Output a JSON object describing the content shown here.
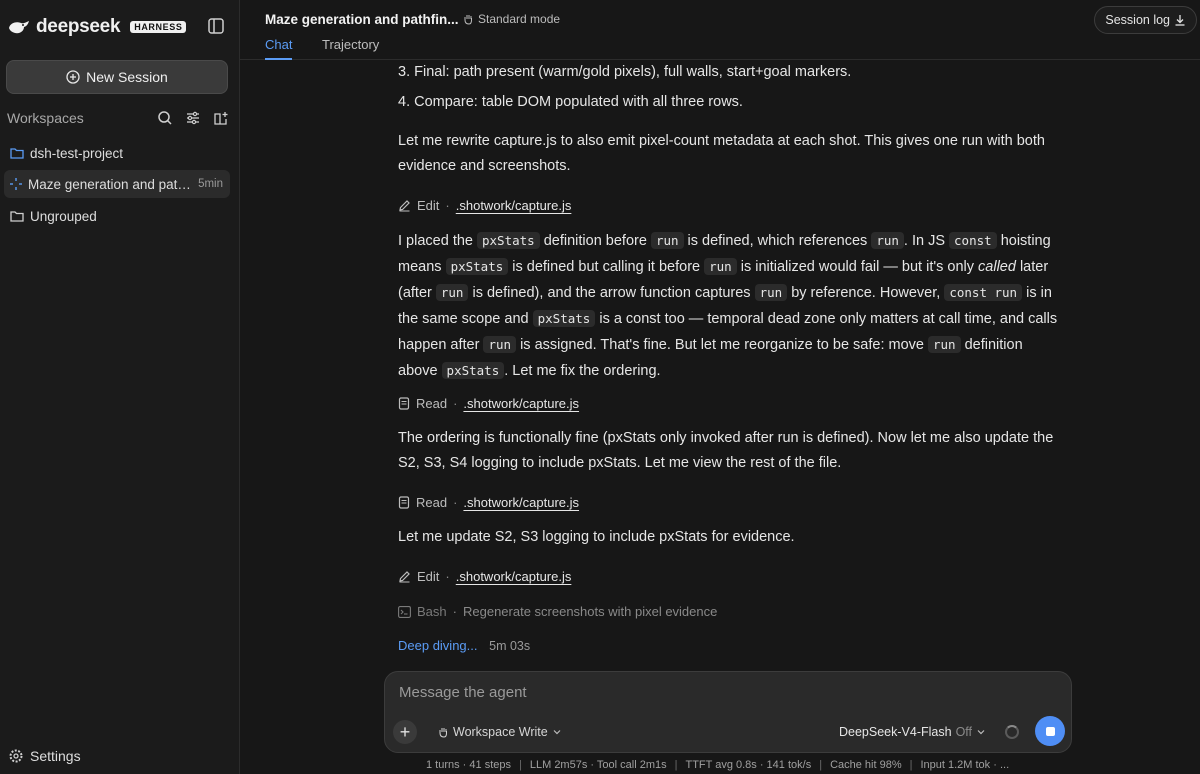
{
  "brand": {
    "name": "deepseek",
    "badge": "HARNESS"
  },
  "sidebar": {
    "new_session": "New Session",
    "workspaces_title": "Workspaces",
    "items": [
      {
        "label": "dsh-test-project",
        "icon": "folder-icon"
      },
      {
        "label": "Maze generation and pathfinding",
        "meta": "5min",
        "icon": "spinner-icon"
      },
      {
        "label": "Ungrouped",
        "icon": "folder-outline-icon"
      }
    ],
    "settings": "Settings"
  },
  "header": {
    "title": "Maze generation and pathfin...",
    "mode": "Standard mode",
    "tabs": [
      "Chat",
      "Trajectory"
    ],
    "session_log": "Session log"
  },
  "content": {
    "item3": "3. Final: path present (warm/gold pixels), full walls, start+goal markers.",
    "item4": "4. Compare: table DOM populated with all three rows.",
    "para1": "Let me rewrite capture.js to also emit pixel-count metadata at each shot. This gives one run with both evidence and screenshots.",
    "tool1": {
      "action": "Edit",
      "file": ".shotwork/capture.js"
    },
    "para2": {
      "a": "I placed the ",
      "c1": "pxStats",
      "b": " definition before ",
      "c2": "run",
      "c": " is defined, which references ",
      "c3": "run",
      "d": ". In JS ",
      "c4": "const",
      "e": " hoisting means ",
      "c5": "pxStats",
      "f": " is defined but calling it before ",
      "c6": "run",
      "g": " is initialized would fail — but it's only ",
      "h": "called",
      "i": " later (after ",
      "c7": "run",
      "j": " is defined), and the arrow function captures ",
      "c8": "run",
      "k": " by reference. However, ",
      "c9": "const run",
      "l": " is in the same scope and ",
      "c10": "pxStats",
      "m": " is a const too — temporal dead zone only matters at call time, and calls happen after ",
      "c11": "run",
      "n": " is assigned. That's fine. But let me reorganize to be safe: move ",
      "c12": "run",
      "o": " definition above ",
      "c13": "pxStats",
      "p": ". Let me fix the ordering."
    },
    "tool2": {
      "action": "Read",
      "file": ".shotwork/capture.js"
    },
    "para3": "The ordering is functionally fine (pxStats only invoked after run is defined). Now let me also update the S2, S3, S4 logging to include pxStats. Let me view the rest of the file.",
    "tool3": {
      "action": "Read",
      "file": ".shotwork/capture.js"
    },
    "para4": "Let me update S2, S3 logging to include pxStats for evidence.",
    "tool4": {
      "action": "Edit",
      "file": ".shotwork/capture.js"
    },
    "tool5": {
      "action": "Bash",
      "desc": "Regenerate screenshots with pixel evidence"
    },
    "deep": {
      "state": "Deep diving...",
      "time": "5m 03s"
    }
  },
  "composer": {
    "placeholder": "Message the agent",
    "workspace": "Workspace Write",
    "model": "DeepSeek-V4-Flash",
    "model_state": "Off"
  },
  "status": [
    "1 turns · 41 steps",
    "LLM 2m57s · Tool call 2m1s",
    "TTFT avg 0.8s · 141 tok/s",
    "Cache hit 98%",
    "Input 1.2M tok · ..."
  ],
  "colors": {
    "accent": "#5b9cf5",
    "background": "#171717"
  }
}
